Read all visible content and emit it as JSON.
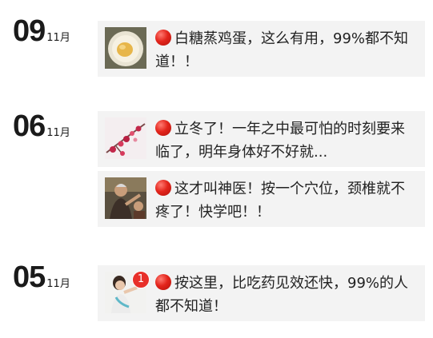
{
  "groups": [
    {
      "day": "09",
      "month": "11月",
      "articles": [
        {
          "title": "白糖蒸鸡蛋，这么有用，99%都不知道！！",
          "thumb_icon": "steamed-egg-image"
        }
      ]
    },
    {
      "day": "06",
      "month": "11月",
      "articles": [
        {
          "title": "立冬了！一年之中最可怕的时刻要来临了，明年身体好不好就...",
          "thumb_icon": "red-blossom-image"
        },
        {
          "title": "这才叫神医！按一个穴位，颈椎就不疼了！快学吧！！",
          "thumb_icon": "doctor-massage-image"
        }
      ]
    },
    {
      "day": "05",
      "month": "11月",
      "articles": [
        {
          "title": "按这里，比吃药见效还快，99%的人都不知道！",
          "thumb_icon": "woman-neck-image",
          "badge": "1"
        }
      ]
    }
  ],
  "colors": {
    "card_bg": "#f3f3f3",
    "dot_red": "#e3251c",
    "badge_red": "#e8302a"
  }
}
